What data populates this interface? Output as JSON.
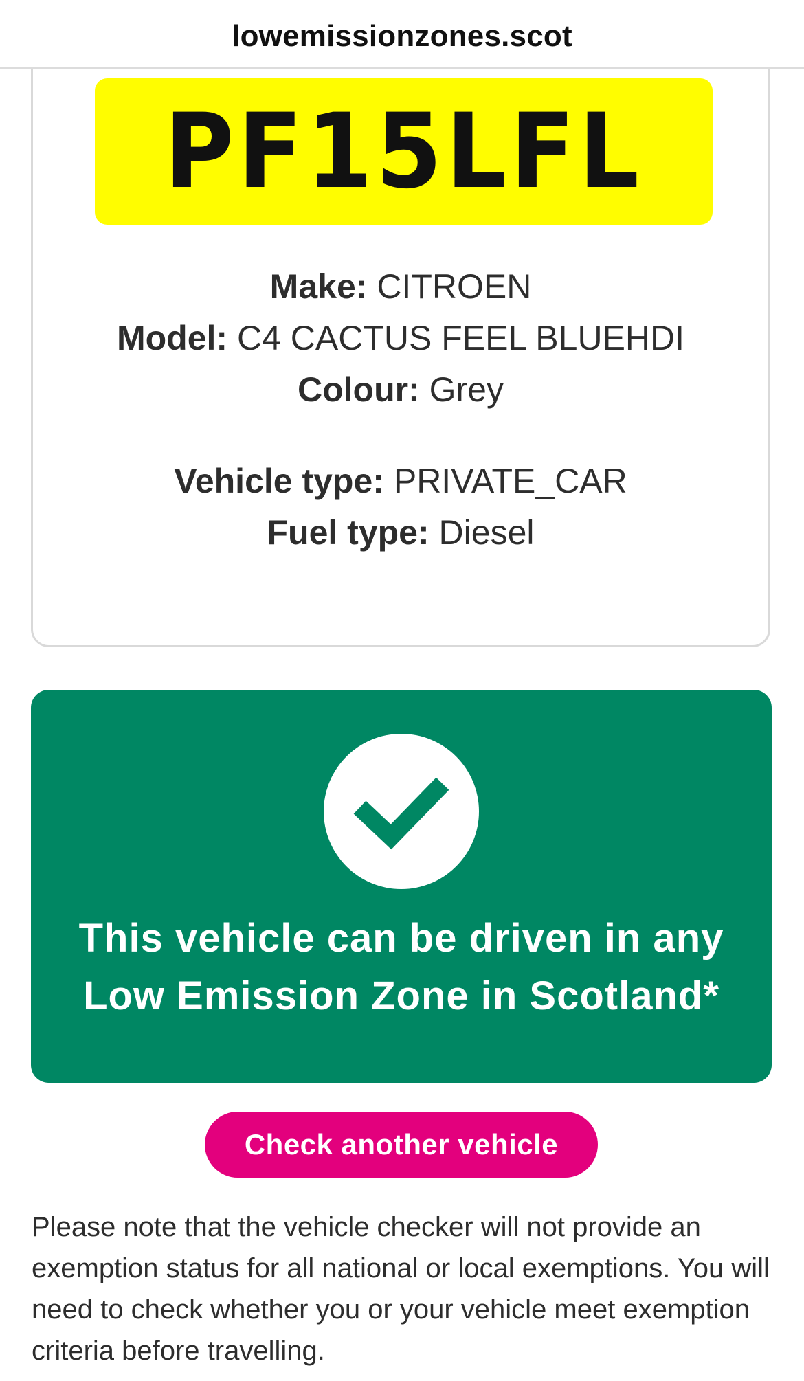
{
  "browser": {
    "url": "lowemissionzones.scot"
  },
  "vehicle": {
    "registration": "PF15LFL",
    "details": [
      {
        "label": "Make:",
        "value": "CITROEN"
      },
      {
        "label": "Model:",
        "value": "C4 CACTUS FEEL BLUEHDI"
      },
      {
        "label": "Colour:",
        "value": "Grey"
      }
    ],
    "classification": [
      {
        "label": "Vehicle type:",
        "value": "PRIVATE_CAR"
      },
      {
        "label": "Fuel type:",
        "value": "Diesel"
      }
    ]
  },
  "result": {
    "icon": "checkmark-icon",
    "line1": "This vehicle can be driven in any",
    "line2": "Low Emission Zone in Scotland*",
    "color": "#008763"
  },
  "actions": {
    "check_another_label": "Check another vehicle",
    "button_color": "#e3007d"
  },
  "note": {
    "text": "Please note that the vehicle checker will not provide an exemption status for all national or local exemptions. You will need to check whether you or your vehicle meet exemption criteria before travelling."
  }
}
